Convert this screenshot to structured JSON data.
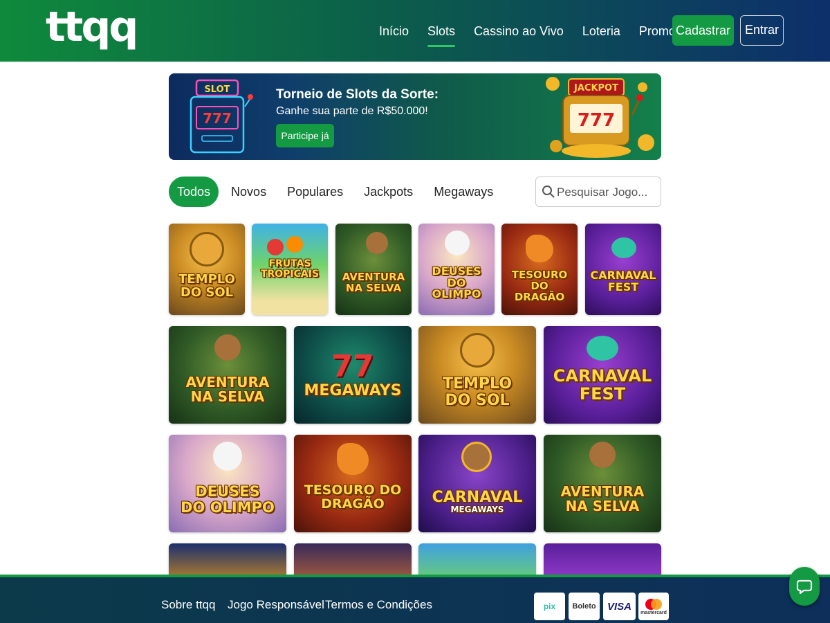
{
  "header": {
    "logo": "ttqq",
    "nav": [
      "Início",
      "Slots",
      "Cassino ao Vivo",
      "Loteria",
      "Promoções"
    ],
    "active_nav": "Slots",
    "register_label": "Cadastrar",
    "login_label": "Entrar"
  },
  "banner": {
    "slot_label": "SLOT",
    "title": "Torneio de Slots da Sorte:",
    "subtitle": "Ganhe sua parte de R$50.000!",
    "cta_label": "Participe já",
    "jackpot_label": "JACKPOT",
    "reels": "777"
  },
  "filters": {
    "tabs": [
      "Todos",
      "Novos",
      "Populares",
      "Jackpots",
      "Megaways"
    ],
    "active": "Todos",
    "search_placeholder": "Pesquisar Jogo..."
  },
  "games": {
    "row1": [
      {
        "line1": "TEMPLO",
        "line2": "DO SOL"
      },
      {
        "line1": "FRUTAS",
        "line2": "TROPICAIS"
      },
      {
        "line1": "AVENTURA",
        "line2": "NA SELVA"
      },
      {
        "line1": "DEUSES",
        "line2": "DO OLIMPO"
      },
      {
        "line1": "TESOURO",
        "line2": "DO DRAGÃO"
      },
      {
        "line1": "CARNAVAL",
        "line2": "FEST"
      }
    ],
    "row2": [
      {
        "line1": "AVENTURA",
        "line2": "NA SELVA"
      },
      {
        "line1": "77",
        "line2": "MEGAWAYS"
      },
      {
        "line1": "TEMPLO",
        "line2": "DO SOL"
      },
      {
        "line1": "CARNAVAL",
        "line2": "FEST"
      }
    ],
    "row3": [
      {
        "line1": "DEUSES",
        "line2": "DO OLIMPO"
      },
      {
        "line1": "TESOURO DO",
        "line2": "DRAGÃO"
      },
      {
        "line1": "CARNAVAL",
        "line2": "MEGAWAYS"
      },
      {
        "line1": "AVENTURA",
        "line2": "NA SELVA"
      }
    ]
  },
  "footer": {
    "links": [
      "Sobre ttqq",
      "Jogo Responsável",
      "Termos e Condições"
    ],
    "payments": [
      "pix",
      "Boleto",
      "VISA",
      "mastercard"
    ]
  },
  "colors": {
    "accent_green": "#139a43",
    "header_start": "#0f8a3c",
    "header_end": "#0d2f6b"
  }
}
